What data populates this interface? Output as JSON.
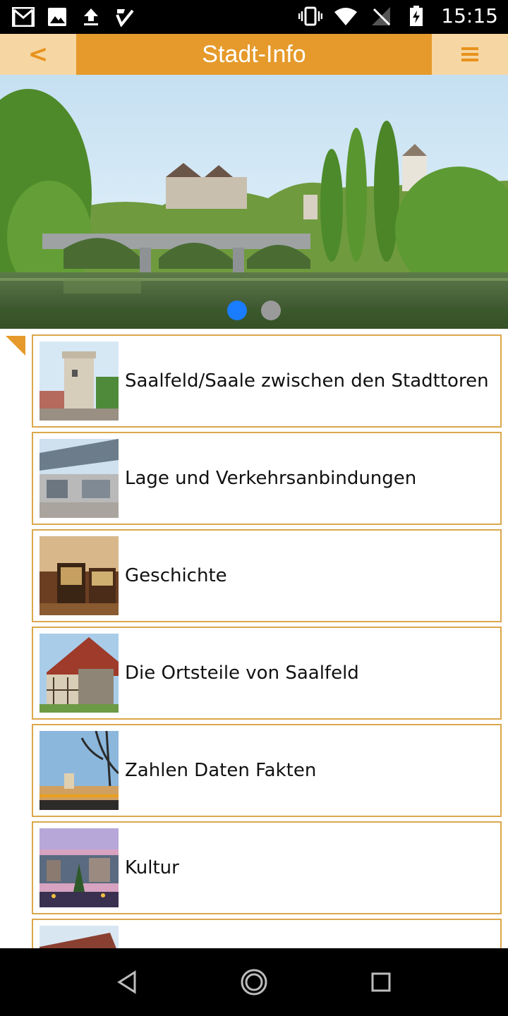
{
  "status_bar": {
    "time": "15:15",
    "left_icons": [
      "gmail-icon",
      "image-icon",
      "upload-icon",
      "task-check-icon"
    ],
    "right_icons": [
      "vibrate-icon",
      "wifi-icon",
      "no-signal-icon",
      "battery-charging-icon"
    ]
  },
  "header": {
    "back_label": "<",
    "title": "Stadt-Info",
    "menu_icon": "hamburger-menu-icon",
    "colors": {
      "bar": "#e59a2b",
      "side": "#f6d6a2",
      "accent": "#e8921c"
    }
  },
  "banner": {
    "image": "river-bridge-castle-photo",
    "pager": {
      "active": 1,
      "total": 2
    }
  },
  "list": {
    "items": [
      {
        "label": "Saalfeld/Saale zwischen den Stadttoren",
        "thumb": "city-gate-tower-photo"
      },
      {
        "label": "Lage und Verkehrsanbindungen",
        "thumb": "train-station-photo"
      },
      {
        "label": "Geschichte",
        "thumb": "museum-interior-photo"
      },
      {
        "label": "Die Ortsteile von Saalfeld",
        "thumb": "half-timbered-church-photo"
      },
      {
        "label": "Zahlen Daten Fakten",
        "thumb": "town-skyline-photo"
      },
      {
        "label": "Kultur",
        "thumb": "christmas-market-photo"
      },
      {
        "label": "",
        "thumb": "building-roof-photo"
      }
    ]
  },
  "nav_bar": {
    "buttons": [
      "back-triangle-icon",
      "home-circle-icon",
      "recents-square-icon"
    ]
  }
}
